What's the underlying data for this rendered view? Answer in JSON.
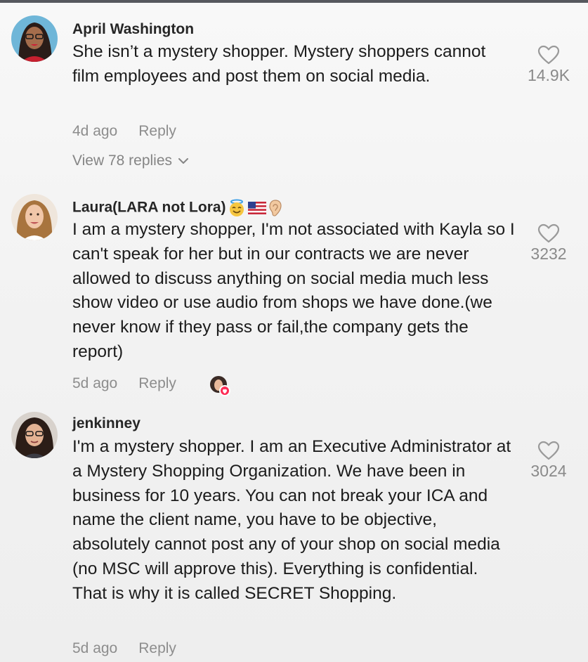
{
  "comments": [
    {
      "username": "April Washington",
      "text": "She isn’t a mystery shopper. Mystery shoppers cannot film employees and post them on social media.",
      "time": "4d ago",
      "reply": "Reply",
      "view_replies": "View 78 replies",
      "likes": "14.9K",
      "avatar": "avatar-woman-glasses-red"
    },
    {
      "username": "Laura(LARA not Lora)",
      "username_emojis": [
        "halo-smile-emoji",
        "us-flag-emoji",
        "ear-emoji"
      ],
      "text": "I am a mystery shopper, I'm not associated with Kayla so I can't speak for her but in our contracts we are never allowed to discuss anything on social media much less show video or use audio from shops we have done.(we never know if they pass or fail,the company gets the report)",
      "time": "5d ago",
      "reply": "Reply",
      "likes": "3232",
      "avatar": "avatar-woman-blonde",
      "creator_liked": true
    },
    {
      "username": "jenkinney",
      "text": "I'm a mystery shopper. I am an Executive Administrator at a Mystery Shopping Organization. We have been in business for 10 years. You can not break your ICA and name the client name, you have to be objective, absolutely cannot post any of your shop on social media (no MSC will approve this). Everything is confidential. That is why it is called SECRET Shopping.",
      "time": "5d ago",
      "reply": "Reply",
      "likes": "3024",
      "avatar": "avatar-woman-dark-hair-glasses"
    }
  ],
  "colors": {
    "username": "#262626",
    "text": "#1c1c1c",
    "meta": "#8d8d8d",
    "heart_outline": "#9a9a9a",
    "creator_badge": "#fe2c55"
  }
}
